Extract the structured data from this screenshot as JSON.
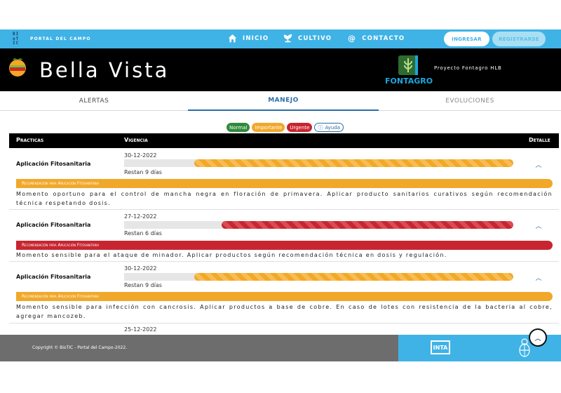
{
  "topnav": {
    "logo_text": "BIoTIC",
    "portal_label": "PORTAL DEL CAMPO",
    "links": [
      {
        "label": "INICIO",
        "icon": "home-icon"
      },
      {
        "label": "CULTIVO",
        "icon": "plant-icon"
      },
      {
        "label": "CONTACTO",
        "icon": "at-icon"
      }
    ],
    "login_label": "INGRESAR",
    "register_label": "REGISTRARSE"
  },
  "header": {
    "title": "Bella Vista",
    "partner_logo_text": "FONTAGRO",
    "project_label": "Proyecto Fontagro HLB"
  },
  "tabs": [
    {
      "label": "ALERTAS",
      "active": false
    },
    {
      "label": "MANEJO",
      "active": true
    },
    {
      "label": "EVOLUCIONES",
      "active": false
    }
  ],
  "legend": {
    "normal": "Normal",
    "importante": "Importante",
    "urgente": "Urgente",
    "ayuda": "Ayuda"
  },
  "table": {
    "headers": {
      "practicas": "Practicas",
      "vigencia": "Vigencia",
      "detalle": "Detalle"
    },
    "rows": [
      {
        "practice": "Aplicación Fitosanitaria",
        "date": "30-12-2022",
        "remaining": "Restan 9 días",
        "level": "importante",
        "progress": 0.82,
        "rec_title": "Recomendación para Aplicación Fitosanitaria",
        "rec_text": "Momento oportuno para el control de mancha negra en floración de primavera. Aplicar producto sanitarios curativos según recomendación técnica respetando dosis."
      },
      {
        "practice": "Aplicación Fitosanitaria",
        "date": "27-12-2022",
        "remaining": "Restan 6 días",
        "level": "urgente",
        "progress": 0.75,
        "rec_title": "Recomendación para Aplicación Fitosanitaria",
        "rec_text": "Momento sensible para el ataque de minador. Aplicar productos según recomendación técnica en dosis y regulación."
      },
      {
        "practice": "Aplicación Fitosanitaria",
        "date": "30-12-2022",
        "remaining": "Restan 9 días",
        "level": "importante",
        "progress": 0.82,
        "rec_title": "Recomendación para Aplicación Fitosanitaria",
        "rec_text": "Momento sensible para infección con cancrosis. Aplicar productos a base de cobre. En caso de lotes con resistencia de la bacteria al cobre, agregar mancozeb."
      },
      {
        "practice": "",
        "date": "25-12-2022"
      }
    ]
  },
  "footer": {
    "copyright": "Copyright © BioTIC - Portal del Campo-2022.",
    "inta_logo": "INTA"
  },
  "colors": {
    "nav_blue": "#3fb3e6",
    "header_black": "#000000",
    "importante": "#f1a82a",
    "urgente": "#c72631",
    "normal": "#2e8b3a",
    "tab_active": "#2a6ea7"
  }
}
